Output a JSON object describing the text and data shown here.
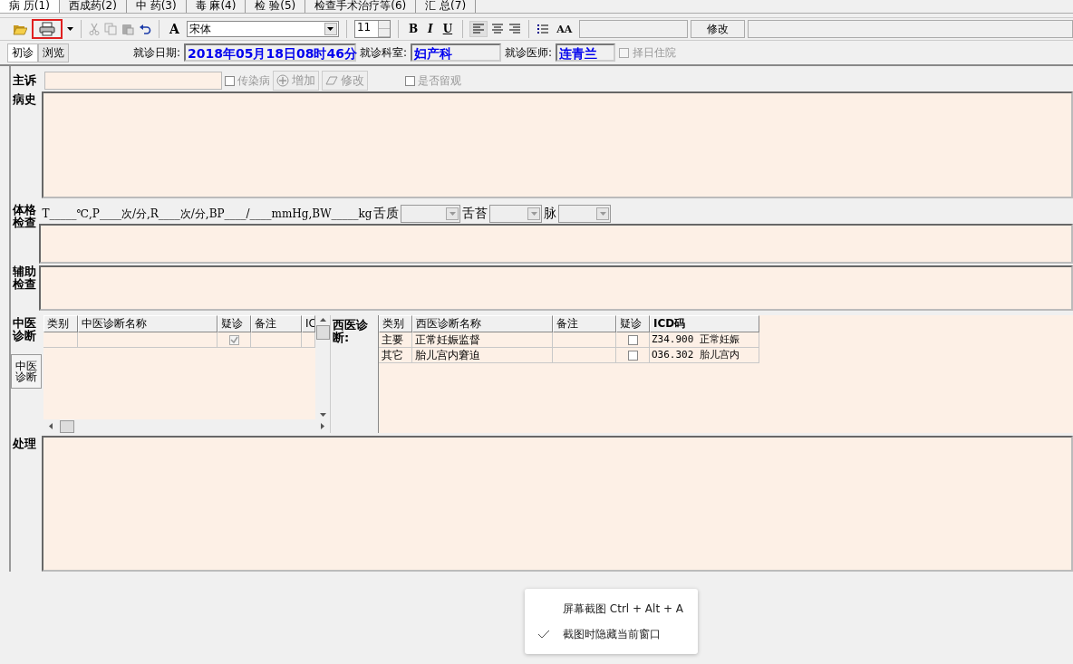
{
  "tabs": [
    {
      "label": "病 历(1)",
      "selected": true
    },
    {
      "label": "西成药(2)",
      "selected": false
    },
    {
      "label": "中 药(3)",
      "selected": false
    },
    {
      "label": "毒 麻(4)",
      "selected": false
    },
    {
      "label": "检 验(5)",
      "selected": false
    },
    {
      "label": "检查手术治疗等(6)",
      "selected": false
    },
    {
      "label": "汇 总(7)",
      "selected": false
    }
  ],
  "toolbar": {
    "print_highlighted": true,
    "font_button": "A",
    "font": "宋体",
    "size": "11",
    "bold": "B",
    "italic": "I",
    "underline": "U",
    "case_button": "AA",
    "edit_button": "修改"
  },
  "visit_tabs": [
    {
      "label": "初诊",
      "selected": true
    },
    {
      "label": "浏览",
      "selected": false
    }
  ],
  "visit": {
    "date_label": "就诊日期:",
    "date": "2018年05月18日08时46分",
    "dept_label": "就诊科室:",
    "dept": "妇产科",
    "doctor_label": "就诊医师:",
    "doctor": "连青兰",
    "admit": {
      "label": "择日住院",
      "checked": false,
      "disabled": true
    }
  },
  "complaint": {
    "label": "主诉",
    "infectious": {
      "label": "传染病",
      "checked": false
    },
    "add_button": "增加",
    "edit_button": "修改",
    "observe": {
      "label": "是否留观",
      "checked": false
    }
  },
  "history": {
    "label": "病史"
  },
  "exam": {
    "label": "体格检查",
    "vitals": "T_____℃,P____次/分,R____次/分,BP____/____mmHg,BW_____kg",
    "tongue_label": "舌质",
    "coating_label": "舌苔",
    "pulse_label": "脉"
  },
  "aux": {
    "label": "辅助检查"
  },
  "tcm": {
    "label": "中医诊断",
    "side_button": "中医诊断",
    "columns": [
      "类别",
      "中医诊断名称",
      "疑诊",
      "备注",
      "IC"
    ],
    "rows": [
      {
        "suspected": true
      }
    ]
  },
  "western": {
    "label": "西医诊断:",
    "columns": [
      "类别",
      "西医诊断名称",
      "备注",
      "疑诊",
      "ICD码"
    ],
    "rows": [
      {
        "category": "主要",
        "name": "正常妊娠监督",
        "suspected": false,
        "icd": "Z34.900 正常妊娠"
      },
      {
        "category": "其它",
        "name": "胎儿宫内窘迫",
        "suspected": false,
        "icd": "O36.302 胎儿宫内"
      }
    ]
  },
  "treatment": {
    "label": "处理"
  },
  "context_menu": {
    "items": [
      {
        "label": "屏幕截图 Ctrl + Alt + A",
        "checked": false
      },
      {
        "label": "截图时隐藏当前窗口",
        "checked": true
      }
    ]
  }
}
